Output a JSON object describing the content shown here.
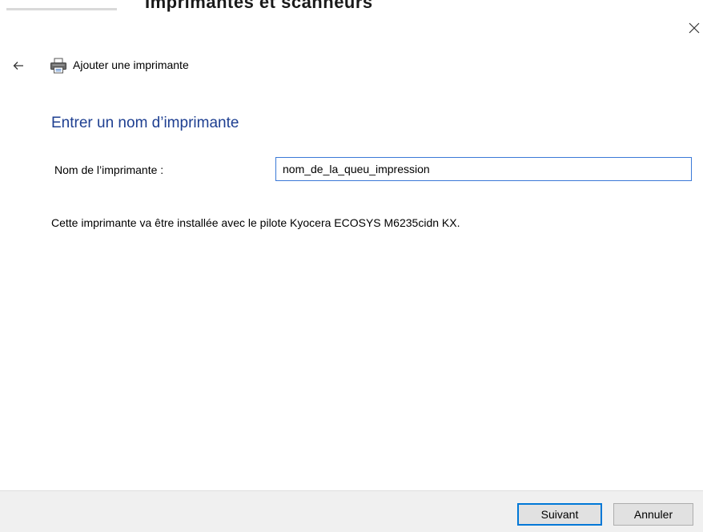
{
  "background_window": {
    "title": "Imprimantes et scanneurs"
  },
  "wizard": {
    "title": "Ajouter une imprimante",
    "heading": "Entrer un nom d’imprimante",
    "field_label": "Nom de l’imprimante :",
    "printer_name_value": "nom_de_la_queu_impression",
    "info_text": "Cette imprimante va être installée avec le pilote Kyocera ECOSYS M6235cidn KX."
  },
  "buttons": {
    "next_label": "Suivant",
    "cancel_label": "Annuler"
  },
  "icons": {
    "close": "close-icon",
    "back": "back-arrow-icon",
    "printer": "printer-icon"
  },
  "colors": {
    "heading": "#1e3f91",
    "focus_border": "#0078d7",
    "footer_bg": "#f0f0f0"
  }
}
